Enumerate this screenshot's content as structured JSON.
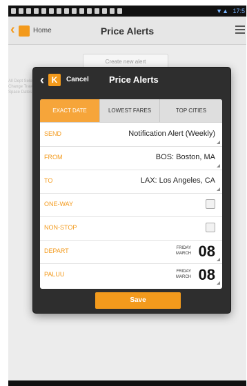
{
  "status_bar": {
    "time": "17:5",
    "signal": "▼▲"
  },
  "app_bar": {
    "home_label": "Home",
    "title": "Price Alerts"
  },
  "background": {
    "create_button": "Create new alert",
    "bg_text": "All Dept Select Change Travel Space Dates"
  },
  "dialog": {
    "cancel_label": "Cancel",
    "title": "Price Alerts",
    "logo_letter": "K",
    "tabs": [
      {
        "label": "EXACT DATE",
        "active": true
      },
      {
        "label": "LOWEST FARES",
        "active": false
      },
      {
        "label": "TOP CITIES",
        "active": false
      }
    ],
    "rows": {
      "send": {
        "label": "SEND",
        "value": "Notification Alert (Weekly)"
      },
      "from": {
        "label": "FROM",
        "value": "BOS: Boston, MA"
      },
      "to": {
        "label": "TO",
        "value": "LAX: Los Angeles, CA"
      },
      "one_way": {
        "label": "ONE-WAY"
      },
      "non_stop": {
        "label": "NON-STOP"
      },
      "depart": {
        "label": "DEPART",
        "weekday": "FRIDAY",
        "month": "MARCH",
        "day": "08"
      },
      "return": {
        "label": "PALUU",
        "weekday": "FRIDAY",
        "month": "MARCH",
        "day": "08"
      }
    },
    "save_label": "Save"
  },
  "colors": {
    "accent": "#f39a1c",
    "tab_active": "#f6a53a",
    "dialog_bg": "#2e2e2e"
  }
}
